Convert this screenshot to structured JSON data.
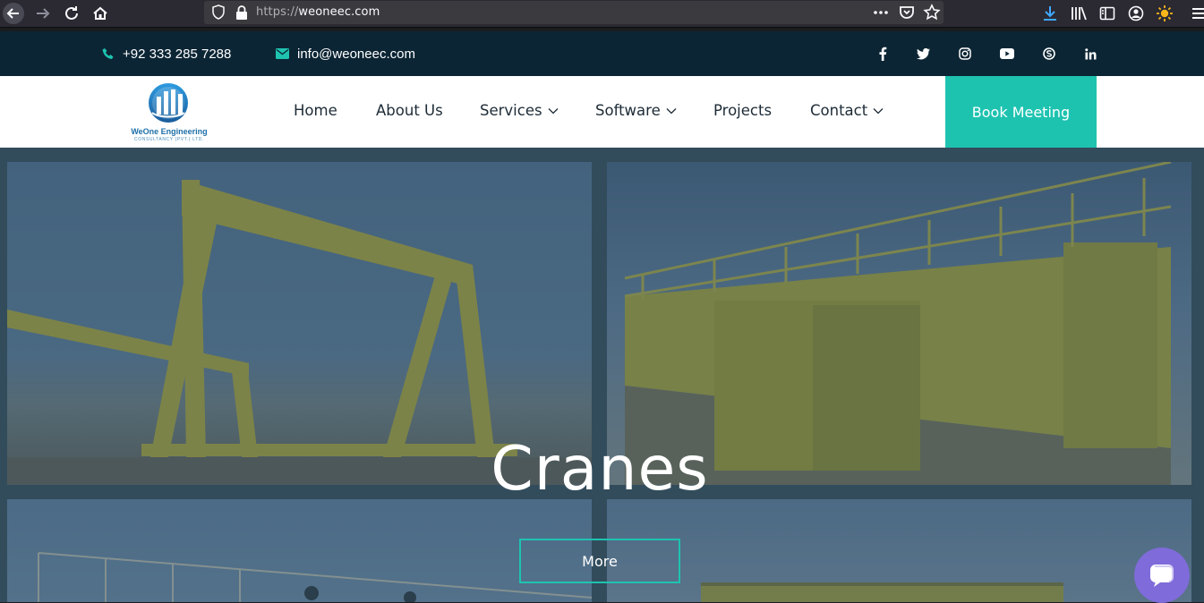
{
  "browser": {
    "url_protocol": "https://",
    "url_host": "weoneec.com"
  },
  "topbar": {
    "phone": "+92 333 285 7288",
    "email": "info@weoneec.com",
    "social_icons": [
      "facebook-icon",
      "twitter-icon",
      "instagram-icon",
      "youtube-icon",
      "skype-icon",
      "linkedin-icon"
    ]
  },
  "logo": {
    "name": "WeOne Engineering",
    "subtitle": "CONSULTANCY (PVT.) LTD."
  },
  "nav": {
    "items": [
      {
        "label": "Home",
        "has_dropdown": false
      },
      {
        "label": "About Us",
        "has_dropdown": false
      },
      {
        "label": "Services",
        "has_dropdown": true
      },
      {
        "label": "Software",
        "has_dropdown": true
      },
      {
        "label": "Projects",
        "has_dropdown": false
      },
      {
        "label": "Contact",
        "has_dropdown": true
      }
    ],
    "cta_label": "Book Meeting"
  },
  "hero": {
    "title": "Cranes",
    "button_label": "More"
  },
  "colors": {
    "accent": "#1ec3b0",
    "topbar_bg": "#0c2534",
    "nav_text": "#1d2b36",
    "chat_bubble": "#7f6bd9"
  }
}
